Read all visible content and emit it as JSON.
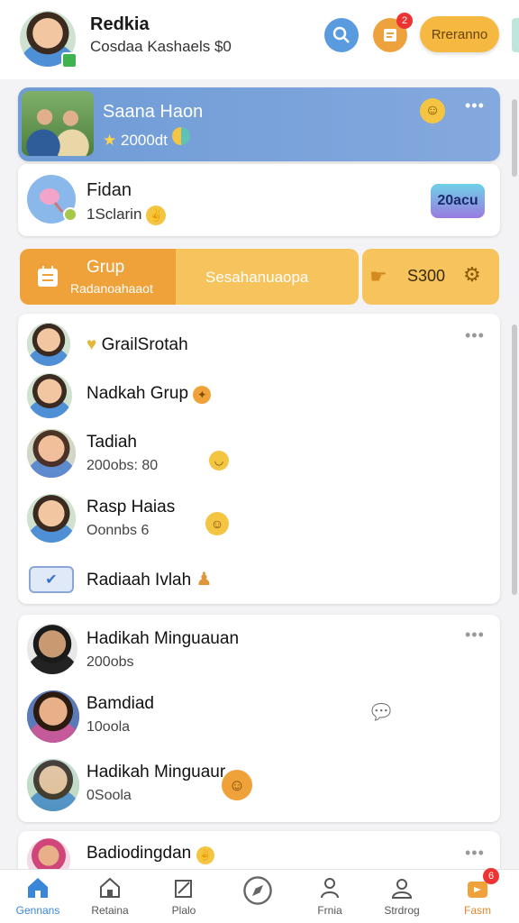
{
  "header": {
    "name": "Redkia",
    "subtitle": "Cosdaa Kashaels $0",
    "action_label": "Rreranno",
    "notification_count": "2"
  },
  "featured": {
    "title": "Saana Haon",
    "meta": "2000dt"
  },
  "card2": {
    "title": "Fidan",
    "subtitle": "1Sclarin",
    "sticker_label": "20acu"
  },
  "group_bar": {
    "label": "Grup",
    "sub": "Radanoahaaot",
    "center": "Sesahanuaopa",
    "amount": "S300"
  },
  "list1": [
    {
      "title": "GrailSrotah",
      "subtitle": ""
    },
    {
      "title": "Nadkah Grup",
      "subtitle": ""
    },
    {
      "title": "Tadiah",
      "subtitle": "200obs: 80"
    },
    {
      "title": "Rasp Haias",
      "subtitle": "Oonnbs 6"
    },
    {
      "title": "Radiaah Ivlah",
      "subtitle": ""
    }
  ],
  "list2": [
    {
      "title": "Hadikah Minguauan",
      "subtitle": "200obs"
    },
    {
      "title": "Bamdiad",
      "subtitle": "10oola"
    },
    {
      "title": "Hadikah Minguaur",
      "subtitle": "0Soola"
    }
  ],
  "list3": [
    {
      "title": "Badiodingdan",
      "subtitle": ""
    }
  ],
  "nav": [
    {
      "label": "Gennans",
      "icon": "home-icon"
    },
    {
      "label": "Retaina",
      "icon": "house-icon"
    },
    {
      "label": "Plalo",
      "icon": "book-icon"
    },
    {
      "label": "",
      "icon": "compass-icon"
    },
    {
      "label": "Frnia",
      "icon": "person-icon"
    },
    {
      "label": "Strdrog",
      "icon": "profile-icon"
    },
    {
      "label": "Fasm",
      "icon": "shop-icon"
    }
  ]
}
